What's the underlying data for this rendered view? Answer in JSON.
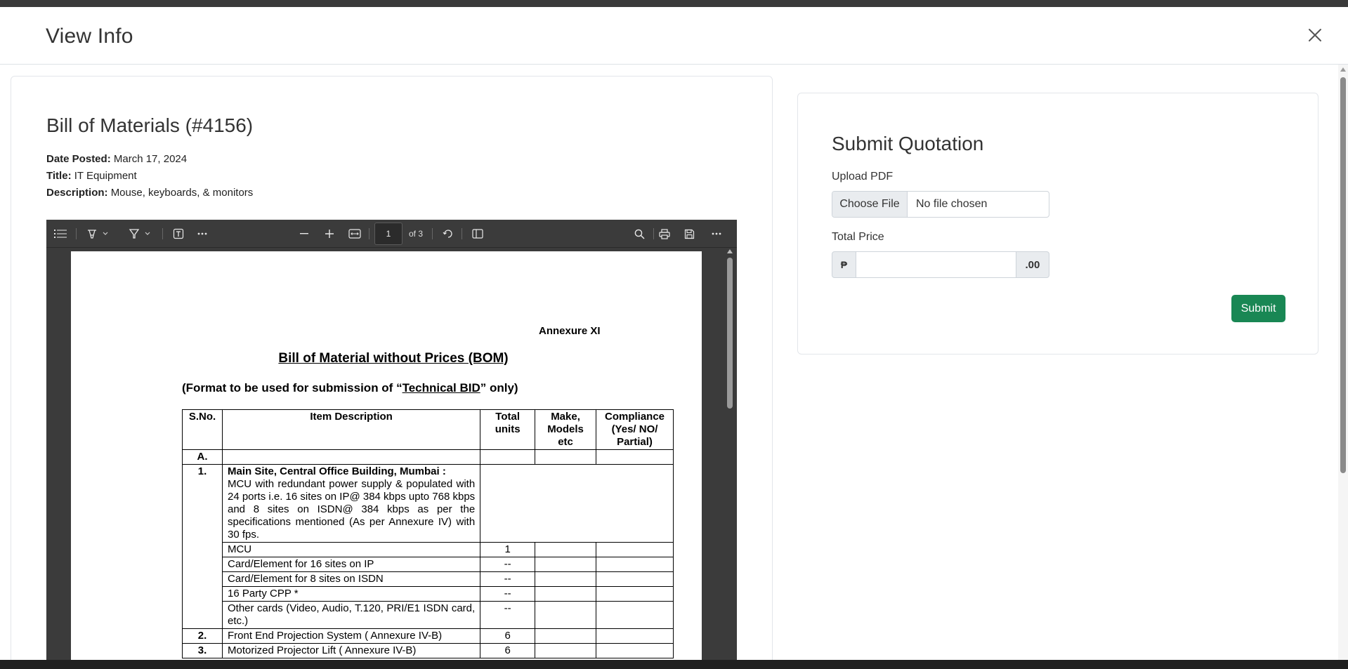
{
  "modal": {
    "title": "View Info"
  },
  "bom": {
    "heading": "Bill of Materials (#4156)",
    "date_label": "Date Posted:",
    "date_value": "March 17, 2024",
    "title_label": "Title:",
    "title_value": "IT Equipment",
    "desc_label": "Description:",
    "desc_value": "Mouse, keyboards, & monitors"
  },
  "pdf": {
    "page_current": "1",
    "page_of": "of 3",
    "annexure": "Annexure XI",
    "doc_title": "Bill of Material without Prices (BOM)",
    "sub_pre": "(Format to be used for submission of “",
    "sub_link": "Technical  BID",
    "sub_post": "” only)",
    "headers": {
      "sno": "S.No.",
      "desc": "Item Description",
      "units": "Total units",
      "make": "Make, Models etc",
      "comp": "Compliance (Yes/ NO/ Partial)"
    },
    "row_a": "A.",
    "row1_sno": "1.",
    "row1_title": "Main Site, Central Office Building, Mumbai :",
    "row1_text": "MCU with redundant power supply & populated with 24 ports i.e. 16 sites on IP@ 384 kbps upto 768 kbps and 8 sites on ISDN@ 384 kbps as per the specifications mentioned (As per Annexure IV) with 30 fps.",
    "sub_items": [
      {
        "desc": "MCU",
        "units": "1"
      },
      {
        "desc": "Card/Element for 16 sites on IP",
        "units": "--"
      },
      {
        "desc": "Card/Element for 8 sites on ISDN",
        "units": "--"
      },
      {
        "desc": "16 Party CPP   *",
        "units": "--"
      },
      {
        "desc": "Other cards (Video, Audio, T.120, PRI/E1 ISDN card,  etc.)",
        "units": "--"
      }
    ],
    "row2": {
      "sno": "2.",
      "desc": "Front End Projection System ( Annexure  IV-B)",
      "units": "6"
    },
    "row3": {
      "sno": "3.",
      "desc": "Motorized Projector Lift  ( Annexure  IV-B)",
      "units": "6"
    }
  },
  "quotation": {
    "title": "Submit Quotation",
    "upload_label": "Upload PDF",
    "choose_file": "Choose File",
    "no_file": "No file chosen",
    "price_label": "Total Price",
    "currency_symbol": "₱",
    "decimal_suffix": ".00",
    "price_value": "",
    "submit": "Submit"
  },
  "colors": {
    "submit_bg": "#198754",
    "pdf_toolbar_bg": "#3b3b3b"
  }
}
